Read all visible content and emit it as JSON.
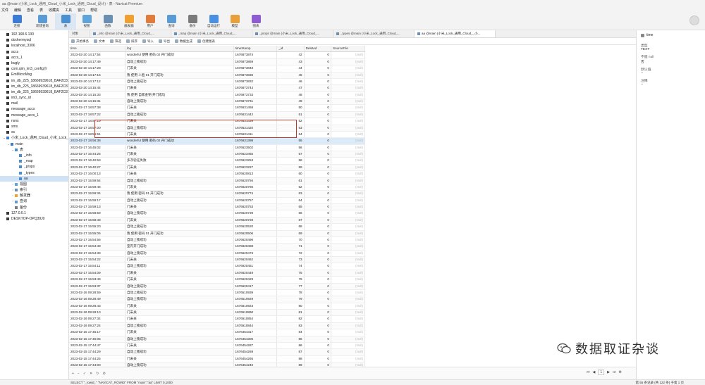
{
  "window": {
    "title": "aa @main (小米_Lock_通用_Cloud_小米_Lock_通用_Cloud_设计) - 表 - Navicat Premium"
  },
  "menu": [
    "文件",
    "编辑",
    "查看",
    "表",
    "收藏夹",
    "工具",
    "窗口",
    "帮助"
  ],
  "toolbar": [
    {
      "label": "连接",
      "color": "#3a7bd5"
    },
    {
      "label": "新建查询",
      "color": "#5b9bd5"
    },
    {
      "label": "表",
      "color": "#4a8fd0",
      "active": true
    },
    {
      "label": "视图",
      "color": "#5fa3d8"
    },
    {
      "label": "函数",
      "color": "#6b8fb3"
    },
    {
      "label": "触发器",
      "color": "#f0a030"
    },
    {
      "label": "用户",
      "color": "#e07b39"
    },
    {
      "label": "查询",
      "color": "#5b9bd5"
    },
    {
      "label": "备份",
      "color": "#7a7a7a"
    },
    {
      "label": "自动运行",
      "color": "#4a90e2"
    },
    {
      "label": "模型",
      "color": "#e8a03a"
    },
    {
      "label": "图表",
      "color": "#8e5bd0"
    }
  ],
  "sidebar": {
    "items": [
      {
        "label": "192.168.6.130",
        "level": 0,
        "color": "#3a3a3a"
      },
      {
        "label": "dockermysql",
        "level": 0,
        "color": "#3a3a3a"
      },
      {
        "label": "localhost_3306",
        "level": 0,
        "color": "#3a3a3a"
      },
      {
        "label": "accs",
        "level": 0,
        "color": "#3a3a3a"
      },
      {
        "label": "accs_1",
        "level": 0,
        "color": "#3a3a3a"
      },
      {
        "label": "bugly",
        "level": 0,
        "color": "#3a3a3a"
      },
      {
        "label": "com.qim_im3_config沙",
        "level": 0,
        "color": "#3a3a3a"
      },
      {
        "label": "EmMicroMsg",
        "level": 0,
        "color": "#3a3a3a"
      },
      {
        "label": "im_db_225_18669939618_BAF2C81F-",
        "level": 0,
        "color": "#3a3a3a"
      },
      {
        "label": "im_db_225_18669939618_BAF2C81F-",
        "level": 0,
        "color": "#3a3a3a"
      },
      {
        "label": "im_db_225_18669939618_BAF2C81F-",
        "level": 0,
        "color": "#3a3a3a"
      },
      {
        "label": "im3_sync_id",
        "level": 0,
        "color": "#3a3a3a"
      },
      {
        "label": "mail",
        "level": 0,
        "color": "#3a3a3a"
      },
      {
        "label": "message_accs",
        "level": 0,
        "color": "#3a3a3a"
      },
      {
        "label": "message_accs_1",
        "level": 0,
        "color": "#3a3a3a"
      },
      {
        "label": "nsns",
        "level": 0,
        "color": "#3a3a3a"
      },
      {
        "label": "sms",
        "level": 0,
        "color": "#3a3a3a"
      },
      {
        "label": "ss",
        "level": 0,
        "color": "#3a3a3a"
      },
      {
        "label": "小米_Lock_通用_Cloud_小米_Lock_通用",
        "level": 0,
        "color": "#3a7bd5",
        "arrow": "v"
      },
      {
        "label": "main",
        "level": 1,
        "color": "#3a7bd5",
        "arrow": "v"
      },
      {
        "label": "表",
        "level": 2,
        "color": "#4a8fd0",
        "arrow": "v"
      },
      {
        "label": "_info",
        "level": 3,
        "color": "#4a8fd0"
      },
      {
        "label": "_map",
        "level": 3,
        "color": "#4a8fd0"
      },
      {
        "label": "_props",
        "level": 3,
        "color": "#4a8fd0"
      },
      {
        "label": "_types",
        "level": 3,
        "color": "#4a8fd0"
      },
      {
        "label": "aa",
        "level": 3,
        "color": "#4a8fd0",
        "selected": true
      },
      {
        "label": "视图",
        "level": 2,
        "color": "#5fa3d8",
        "arrow": ">"
      },
      {
        "label": "索引",
        "level": 2,
        "color": "#6b8fb3",
        "arrow": ">"
      },
      {
        "label": "触发器",
        "level": 2,
        "color": "#f0a030",
        "arrow": ">"
      },
      {
        "label": "查询",
        "level": 2,
        "color": "#5b9bd5",
        "arrow": ">"
      },
      {
        "label": "备份",
        "level": 2,
        "color": "#7a7a7a"
      },
      {
        "label": "127.0.0.1",
        "level": 0,
        "color": "#3a3a3a"
      },
      {
        "label": "DESKTOP-OPQ39J0",
        "level": 0,
        "color": "#3a3a3a"
      }
    ]
  },
  "tabs": [
    {
      "label": "对象",
      "active": false
    },
    {
      "label": "_info @main (小米_Lock_通用_Cloud_...",
      "active": false
    },
    {
      "label": "_map @main (小米_Lock_通用_Cloud_...",
      "active": false
    },
    {
      "label": "_props @main (小米_Lock_通用_Cloud_...",
      "active": false
    },
    {
      "label": "_types @main (小米_Lock_通用_Cloud_...",
      "active": false
    },
    {
      "label": "aa @main (小米_Lock_通用_Cloud__小...",
      "active": true
    }
  ],
  "subtoolbar": [
    "开始事务",
    "文本",
    "筛选",
    "排序",
    "导入",
    "导出",
    "数据生成",
    "创建图表"
  ],
  "table": {
    "columns": [
      "time",
      "log",
      "timeStamp",
      "_id",
      "Deleted",
      "SourceFile"
    ],
    "rows": [
      [
        "2023-02-20 14:17:54",
        "wonderful 使用 密码 02 开门成功",
        "1676873874",
        "42",
        "0",
        "(Null)"
      ],
      [
        "2023-02-20 14:17:49",
        "自动上锁成功",
        "1676873869",
        "43",
        "0",
        "(Null)"
      ],
      [
        "2023-02-20 14:17:28",
        "门未关",
        "1676873848",
        "44",
        "0",
        "(Null)"
      ],
      [
        "2023-02-20 14:17:16",
        "我 使用 人脸 01 开门成功",
        "1676873836",
        "45",
        "0",
        "(Null)"
      ],
      [
        "2023-02-20 14:17:12",
        "自动上锁成功",
        "1676873832",
        "46",
        "0",
        "(Null)"
      ],
      [
        "2023-02-20 14:15:44",
        "门未关",
        "1676873744",
        "47",
        "0",
        "(Null)"
      ],
      [
        "2023-02-20 14:15:33",
        "我 使用 自家金钥 开门成功",
        "1676873733",
        "48",
        "0",
        "(Null)"
      ],
      [
        "2023-02-20 14:15:31",
        "自动上锁成功",
        "1676873731",
        "49",
        "0",
        "(Null)"
      ],
      [
        "2023-02-17 18:57:38",
        "门未关",
        "1676631458",
        "50",
        "0",
        "(Null)"
      ],
      [
        "2023-02-17 18:57:22",
        "自动上锁成功",
        "1676631442",
        "51",
        "0",
        "(Null)"
      ],
      [
        "2023-02-17 18:57:19",
        "门未关",
        "1676631439",
        "52",
        "0",
        "(Null)"
      ],
      [
        "2023-02-17 18:57:00",
        "自动上锁成功",
        "1676631420",
        "53",
        "0",
        "(Null)"
      ],
      [
        "2023-02-17 18:56:51",
        "门未关",
        "1676631411",
        "54",
        "0",
        "(Null)"
      ],
      [
        "2023-02-17 18:56:38",
        "wonderful 使用 密码 02 开门成功",
        "1676631398",
        "55",
        "0",
        "(Null)"
      ],
      [
        "2023-02-17 16:45:02",
        "门未关",
        "1676623502",
        "56",
        "0",
        "(Null)"
      ],
      [
        "2023-02-17 16:44:25",
        "门未关",
        "1676623465",
        "57",
        "0",
        "(Null)"
      ],
      [
        "2023-02-17 16:40:53",
        "多次验证失败",
        "1676623253",
        "58",
        "0",
        "(Null)"
      ],
      [
        "2023-02-17 16:40:27",
        "门未关",
        "1676623227",
        "59",
        "0",
        "(Null)"
      ],
      [
        "2023-02-17 16:00:13",
        "门未关",
        "1676620813",
        "60",
        "0",
        "(Null)"
      ],
      [
        "2023-02-17 15:59:54",
        "自动上锁成功",
        "1676620794",
        "61",
        "0",
        "(Null)"
      ],
      [
        "2023-02-17 15:59:46",
        "门未关",
        "1676620786",
        "62",
        "0",
        "(Null)"
      ],
      [
        "2023-02-17 15:59:34",
        "我 使用 密码 01 开门成功",
        "1676620774",
        "63",
        "0",
        "(Null)"
      ],
      [
        "2023-02-17 15:59:17",
        "自动上锁成功",
        "1676620757",
        "64",
        "0",
        "(Null)"
      ],
      [
        "2023-02-17 15:59:13",
        "门未关",
        "1676620753",
        "65",
        "0",
        "(Null)"
      ],
      [
        "2023-02-17 15:58:59",
        "自动上锁成功",
        "1676620739",
        "66",
        "0",
        "(Null)"
      ],
      [
        "2023-02-17 15:58:48",
        "门未关",
        "1676620728",
        "67",
        "0",
        "(Null)"
      ],
      [
        "2023-02-17 15:55:20",
        "自动上锁成功",
        "1676620520",
        "68",
        "0",
        "(Null)"
      ],
      [
        "2023-02-17 15:55:06",
        "我 使用 密码 01 开门成功",
        "1676620506",
        "69",
        "0",
        "(Null)"
      ],
      [
        "2023-02-17 15:54:56",
        "自动上锁成功",
        "1676620496",
        "70",
        "0",
        "(Null)"
      ],
      [
        "2023-02-17 15:54:48",
        "室内开门成功",
        "1676620488",
        "71",
        "0",
        "(Null)"
      ],
      [
        "2023-02-17 15:54:33",
        "自动上锁成功",
        "1676620473",
        "72",
        "0",
        "(Null)"
      ],
      [
        "2023-02-17 15:54:22",
        "门未关",
        "1676620462",
        "73",
        "0",
        "(Null)"
      ],
      [
        "2023-02-17 15:54:11",
        "自动上锁成功",
        "1676620451",
        "74",
        "0",
        "(Null)"
      ],
      [
        "2023-02-17 15:54:09",
        "门未关",
        "1676620449",
        "75",
        "0",
        "(Null)"
      ],
      [
        "2023-02-17 15:53:49",
        "门未关",
        "1676620429",
        "76",
        "0",
        "(Null)"
      ],
      [
        "2023-02-17 15:53:37",
        "自动上锁成功",
        "1676620417",
        "77",
        "0",
        "(Null)"
      ],
      [
        "2023-02-16 09:28:59",
        "自动上锁成功",
        "1676510939",
        "78",
        "0",
        "(Null)"
      ],
      [
        "2023-02-16 09:28:49",
        "自动上锁成功",
        "1676510929",
        "79",
        "0",
        "(Null)"
      ],
      [
        "2023-02-16 09:28:43",
        "门未关",
        "1676510923",
        "80",
        "0",
        "(Null)"
      ],
      [
        "2023-02-16 09:28:10",
        "门未关",
        "1676510890",
        "81",
        "0",
        "(Null)"
      ],
      [
        "2023-02-16 09:27:34",
        "门未关",
        "1676510854",
        "82",
        "0",
        "(Null)"
      ],
      [
        "2023-02-16 09:27:24",
        "自动上锁成功",
        "1676510844",
        "83",
        "0",
        "(Null)"
      ],
      [
        "2023-02-15 17:45:17",
        "门未关",
        "1676454317",
        "84",
        "0",
        "(Null)"
      ],
      [
        "2023-02-15 17:45:05",
        "自动上锁成功",
        "1676454305",
        "85",
        "0",
        "(Null)"
      ],
      [
        "2023-02-15 17:44:47",
        "门未关",
        "1676454287",
        "86",
        "0",
        "(Null)"
      ],
      [
        "2023-02-15 17:44:29",
        "自动上锁成功",
        "1676454269",
        "87",
        "0",
        "(Null)"
      ],
      [
        "2023-02-15 17:44:25",
        "门未关",
        "1676454265",
        "88",
        "0",
        "(Null)"
      ],
      [
        "2023-02-15 17:44:00",
        "自动上锁成功",
        "1676454240",
        "89",
        "0",
        "(Null)"
      ],
      [
        "2023-02-15 17:43:53",
        "室内开门成功",
        "1676454233",
        "90",
        "0",
        "(Null)"
      ],
      [
        "2023-02-15 17:43:42",
        "自动上锁成功",
        "1676454222",
        "91",
        "0",
        "(Null)"
      ],
      [
        "2023-02-15 17:43:18",
        "门未关",
        "1676454198",
        "92",
        "0",
        "(Null)"
      ],
      [
        "2023-02-15 17:41:42",
        "门未关",
        "1676454102",
        "93",
        "0",
        "(Null)"
      ]
    ],
    "selected_row": 13
  },
  "pager": {
    "page": "1"
  },
  "rightpanel": {
    "title": "time",
    "type_label": "类型",
    "type_value": "TEXT",
    "nn_label": "不是 null",
    "nn_value": "否",
    "def_label": "默认值",
    "def_value": "--",
    "comment_label": "注释",
    "comment_value": "--"
  },
  "status": {
    "sql": "SELECT \"_rowid_\" \"NAVICAT_ROWID\" FROM \"main\".\"aa\" LIMIT 0,1000",
    "records": "第 55 条记录 (共 122 条) 于第 1 页"
  },
  "watermark": {
    "text": "数据取证杂谈"
  }
}
